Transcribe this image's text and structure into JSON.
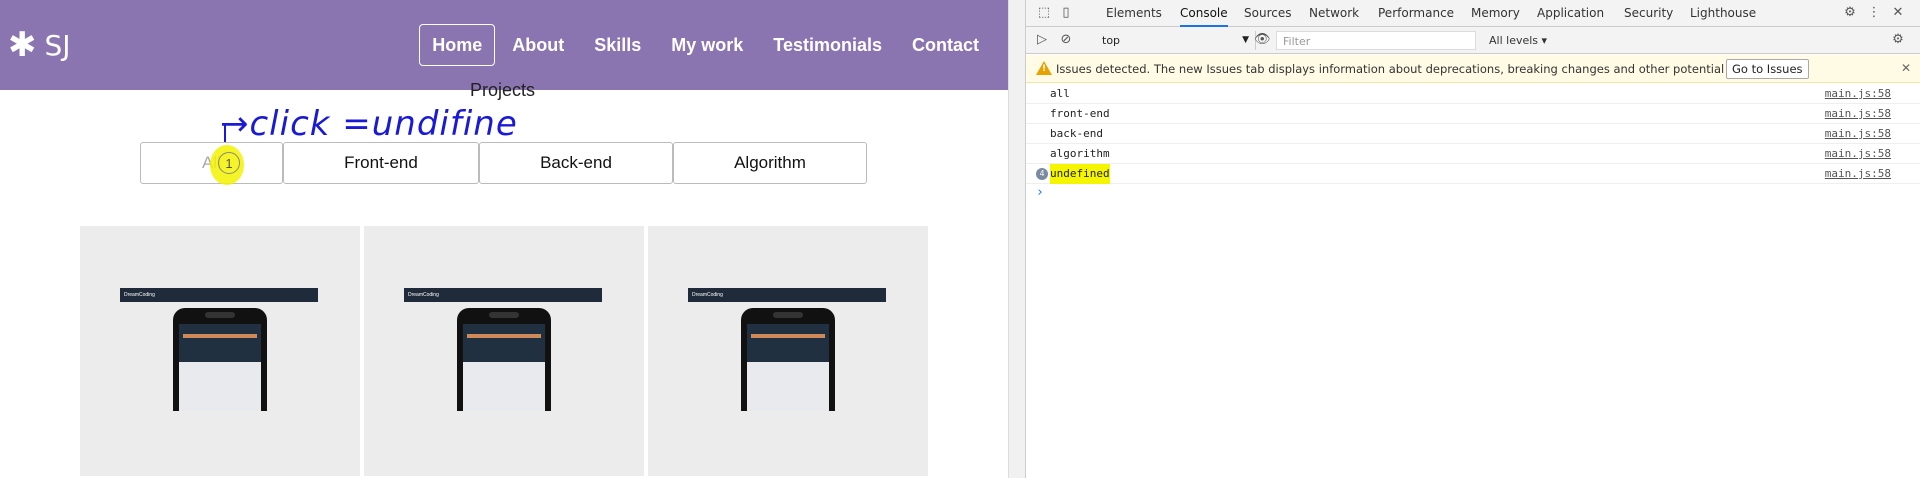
{
  "page": {
    "logo": {
      "text": "SJ",
      "icon": "asterisk-icon"
    },
    "nav": [
      {
        "label": "Home",
        "active": true
      },
      {
        "label": "About",
        "active": false
      },
      {
        "label": "Skills",
        "active": false
      },
      {
        "label": "My work",
        "active": false
      },
      {
        "label": "Testimonials",
        "active": false
      },
      {
        "label": "Contact",
        "active": false
      }
    ],
    "section_title": "Projects",
    "annotation": "→click =undifine",
    "annotation_badge": "1",
    "categories": [
      "All",
      "Front-end",
      "Back-end",
      "Algorithm"
    ],
    "cards": [
      {
        "brand": "DreamCoding"
      },
      {
        "brand": "DreamCoding"
      },
      {
        "brand": "DreamCoding"
      }
    ]
  },
  "devtools": {
    "tabs": [
      "Elements",
      "Console",
      "Sources",
      "Network",
      "Performance",
      "Memory",
      "Application",
      "Security",
      "Lighthouse"
    ],
    "active_tab": "Console",
    "context": "top",
    "filter_placeholder": "Filter",
    "levels": "All levels",
    "issues_message": "Issues detected. The new Issues tab displays information about deprecations, breaking changes and other potential problems.",
    "go_to_issues": "Go to Issues",
    "logs": [
      {
        "message": "all",
        "source": "main.js:58"
      },
      {
        "message": "front-end",
        "source": "main.js:58"
      },
      {
        "message": "back-end",
        "source": "main.js:58"
      },
      {
        "message": "algorithm",
        "source": "main.js:58"
      },
      {
        "message": "undefined",
        "source": "main.js:58",
        "count": "4",
        "highlighted": true
      }
    ],
    "prompt": "›"
  }
}
